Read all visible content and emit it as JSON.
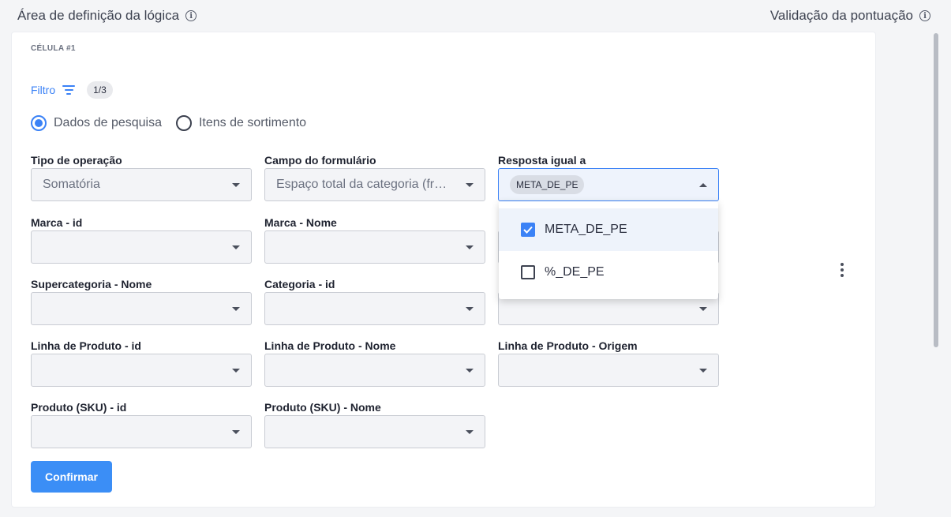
{
  "header": {
    "left_title": "Área de definição da lógica",
    "right_title": "Validação da pontuação",
    "info_glyph": "i"
  },
  "cell": {
    "label": "CÉLULA #1"
  },
  "filter": {
    "label": "Filtro",
    "count": "1/3"
  },
  "radio": {
    "options": [
      {
        "label": "Dados de pesquisa",
        "checked": true
      },
      {
        "label": "Itens de sortimento",
        "checked": false
      }
    ]
  },
  "fields": {
    "tipo_operacao": {
      "label": "Tipo de operação",
      "value": "Somatória"
    },
    "campo_formulario": {
      "label": "Campo do formulário",
      "value": "Espaço total da categoria (frentes)"
    },
    "resposta_igual": {
      "label": "Resposta igual a",
      "chip": "META_DE_PE"
    },
    "marca_id": {
      "label": "Marca - id",
      "value": ""
    },
    "marca_nome": {
      "label": "Marca - Nome",
      "value": ""
    },
    "supercategoria_nome": {
      "label": "Supercategoria - Nome",
      "value": ""
    },
    "categoria_id": {
      "label": "Categoria - id",
      "value": ""
    },
    "linha_produto_id": {
      "label": "Linha de Produto - id",
      "value": ""
    },
    "linha_produto_nome": {
      "label": "Linha de Produto - Nome",
      "value": ""
    },
    "linha_produto_origem": {
      "label": "Linha de Produto - Origem",
      "value": ""
    },
    "produto_sku_id": {
      "label": "Produto (SKU) - id",
      "value": ""
    },
    "produto_sku_nome": {
      "label": "Produto (SKU) - Nome",
      "value": ""
    }
  },
  "dropdown": {
    "options": [
      {
        "label": "META_DE_PE",
        "checked": true
      },
      {
        "label": "%_DE_PE",
        "checked": false
      }
    ]
  },
  "confirm_button": {
    "label": "Confirmar"
  },
  "colors": {
    "accent": "#3b82f6",
    "card": "#ffffff",
    "background": "#f4f5f7"
  }
}
